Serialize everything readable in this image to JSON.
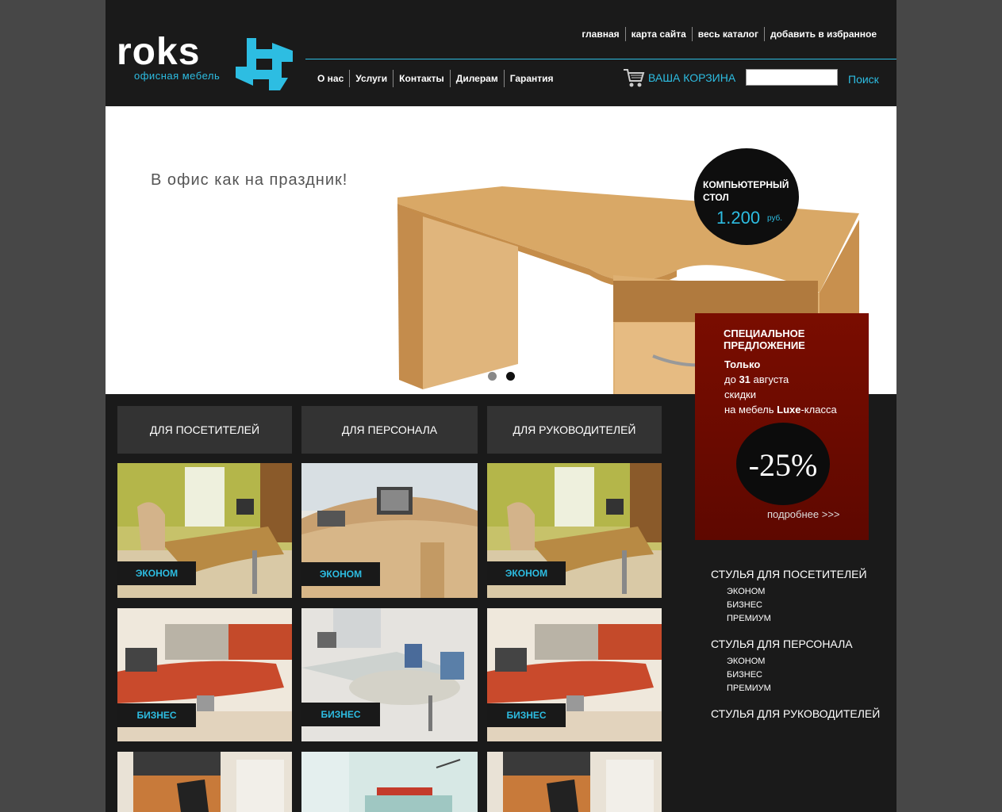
{
  "header": {
    "logo_word": "roks",
    "logo_sub": "офисная мебель",
    "top_links": [
      "главная",
      "карта сайта",
      "весь каталог",
      "добавить в избранное"
    ],
    "main_nav": [
      "О нас",
      "Услуги",
      "Контакты",
      "Дилерам",
      "Гарантия"
    ],
    "cart_label": "ВАША КОРЗИНА",
    "search_value": "",
    "search_button": "Поиск"
  },
  "banner": {
    "slogan": "В офис как на праздник!",
    "price_title": "КОМПЬЮТЕРНЫЙ СТОЛ",
    "price_value": "1.200",
    "price_currency": "руб.",
    "slide_count": 2,
    "active_slide": 2
  },
  "promo": {
    "title_line1": "СПЕЦИАЛЬНОЕ",
    "title_line2": "ПРЕДЛОЖЕНИЕ",
    "line1": "Только",
    "line2_pre": "до ",
    "line2_bold": "31",
    "line2_post": " августа",
    "line3": "скидки",
    "line4_pre": "на мебель ",
    "line4_bold": "Luxe",
    "line4_post": "-класса",
    "discount": "-25%",
    "more": "подробнее >>>"
  },
  "tabs": [
    "ДЛЯ ПОСЕТИТЕЛЕЙ",
    "ДЛЯ ПЕРСОНАЛА",
    "ДЛЯ РУКОВОДИТЕЛЕЙ"
  ],
  "tiles": {
    "row1": [
      "ЭКОНОМ",
      "ЭКОНОМ",
      "ЭКОНОМ"
    ],
    "row2": [
      "БИЗНЕС",
      "БИЗНЕС",
      "БИЗНЕС"
    ]
  },
  "side_menu": {
    "group1": {
      "title": "СТУЛЬЯ ДЛЯ ПОСЕТИТЕЛЕЙ",
      "items": [
        "ЭКОНОМ",
        "БИЗНЕС",
        "ПРЕМИУМ"
      ]
    },
    "group2": {
      "title": "СТУЛЬЯ ДЛЯ ПЕРСОНАЛА",
      "items": [
        "ЭКОНОМ",
        "БИЗНЕС",
        "ПРЕМИУМ"
      ]
    },
    "group3": {
      "title": "СТУЛЬЯ ДЛЯ РУКОВОДИТЕЛЕЙ"
    }
  },
  "colors": {
    "accent": "#2dbde2",
    "promo": "#6b0b00",
    "page_bg": "#1a1a1a",
    "outer_bg": "#474747"
  }
}
